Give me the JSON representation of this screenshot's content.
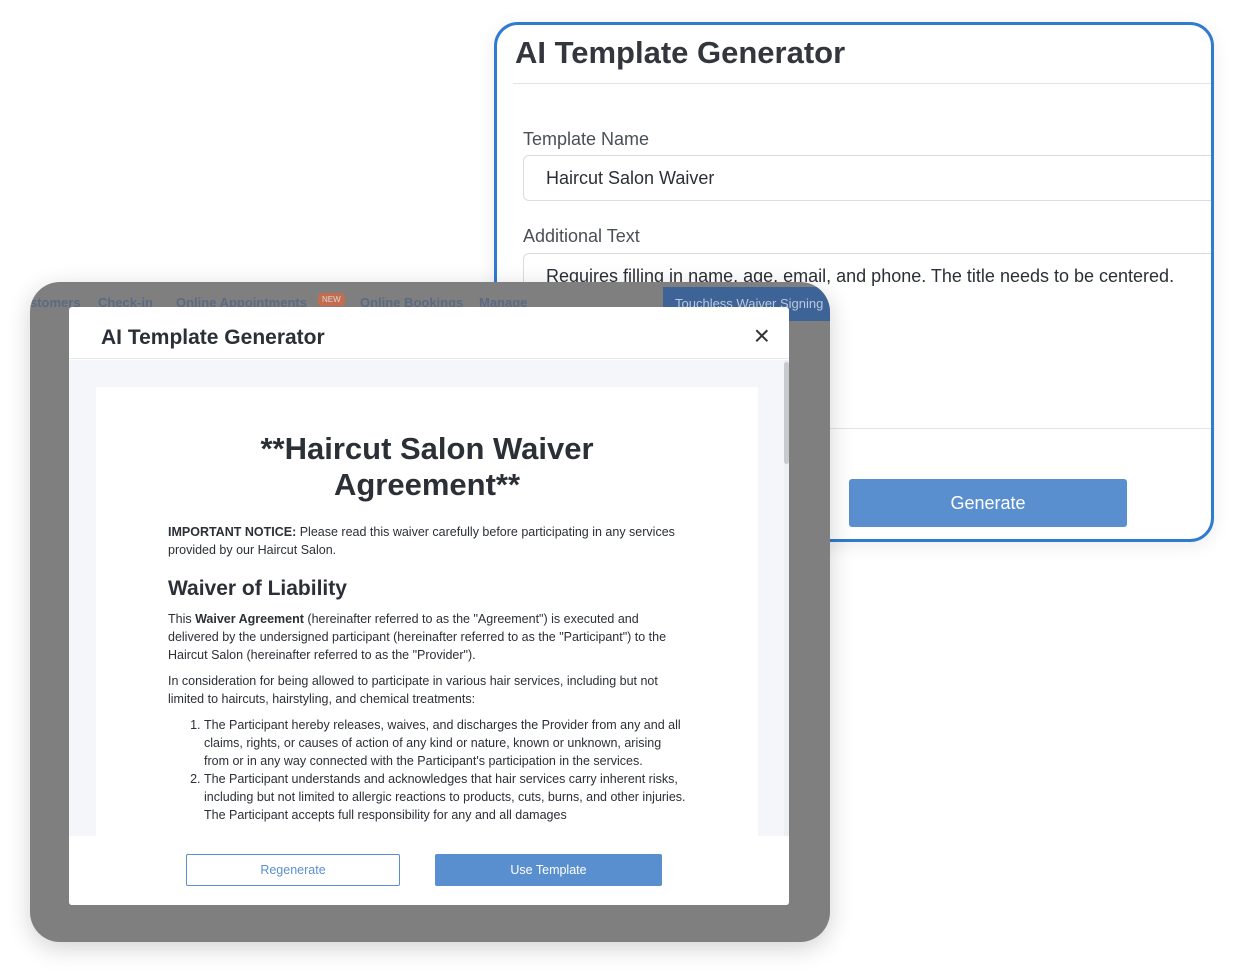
{
  "generator_form": {
    "title": "AI Template Generator",
    "template_name_label": "Template Name",
    "template_name_value": "Haircut Salon Waiver",
    "additional_text_label": "Additional Text",
    "additional_text_value": "Requires filling in name, age, email, and phone. The title needs to be centered.",
    "generate_label": "Generate"
  },
  "app_nav": {
    "items": [
      "stomers",
      "Check-in",
      "Online Appointments",
      "Online Bookings",
      "Manage"
    ],
    "new_badge": "NEW",
    "touchless_label": "Touchless Waiver Signing"
  },
  "modal": {
    "title": "AI Template Generator",
    "close_icon": "×",
    "regenerate_label": "Regenerate",
    "use_template_label": "Use Template"
  },
  "document": {
    "title": "**Haircut Salon Waiver Agreement**",
    "notice_bold": "IMPORTANT NOTICE:",
    "notice_text": " Please read this waiver carefully before participating in any services provided by our Haircut Salon.",
    "section_heading": "Waiver of Liability",
    "para1_pre": "This ",
    "para1_bold": "Waiver Agreement",
    "para1_post": " (hereinafter referred to as the \"Agreement\") is executed and delivered by the undersigned participant (hereinafter referred to as the \"Participant\") to the Haircut Salon (hereinafter referred to as the \"Provider\").",
    "para2": "In consideration for being allowed to participate in various hair services, including but not limited to haircuts, hairstyling, and chemical treatments:",
    "list": [
      "The Participant hereby releases, waives, and discharges the Provider from any and all claims, rights, or causes of action of any kind or nature, known or unknown, arising from or in any way connected with the Participant's participation in the services.",
      "The Participant understands and acknowledges that hair services carry inherent risks, including but not limited to allergic reactions to products, cuts, burns, and other injuries. The Participant accepts full responsibility for any and all damages"
    ]
  }
}
